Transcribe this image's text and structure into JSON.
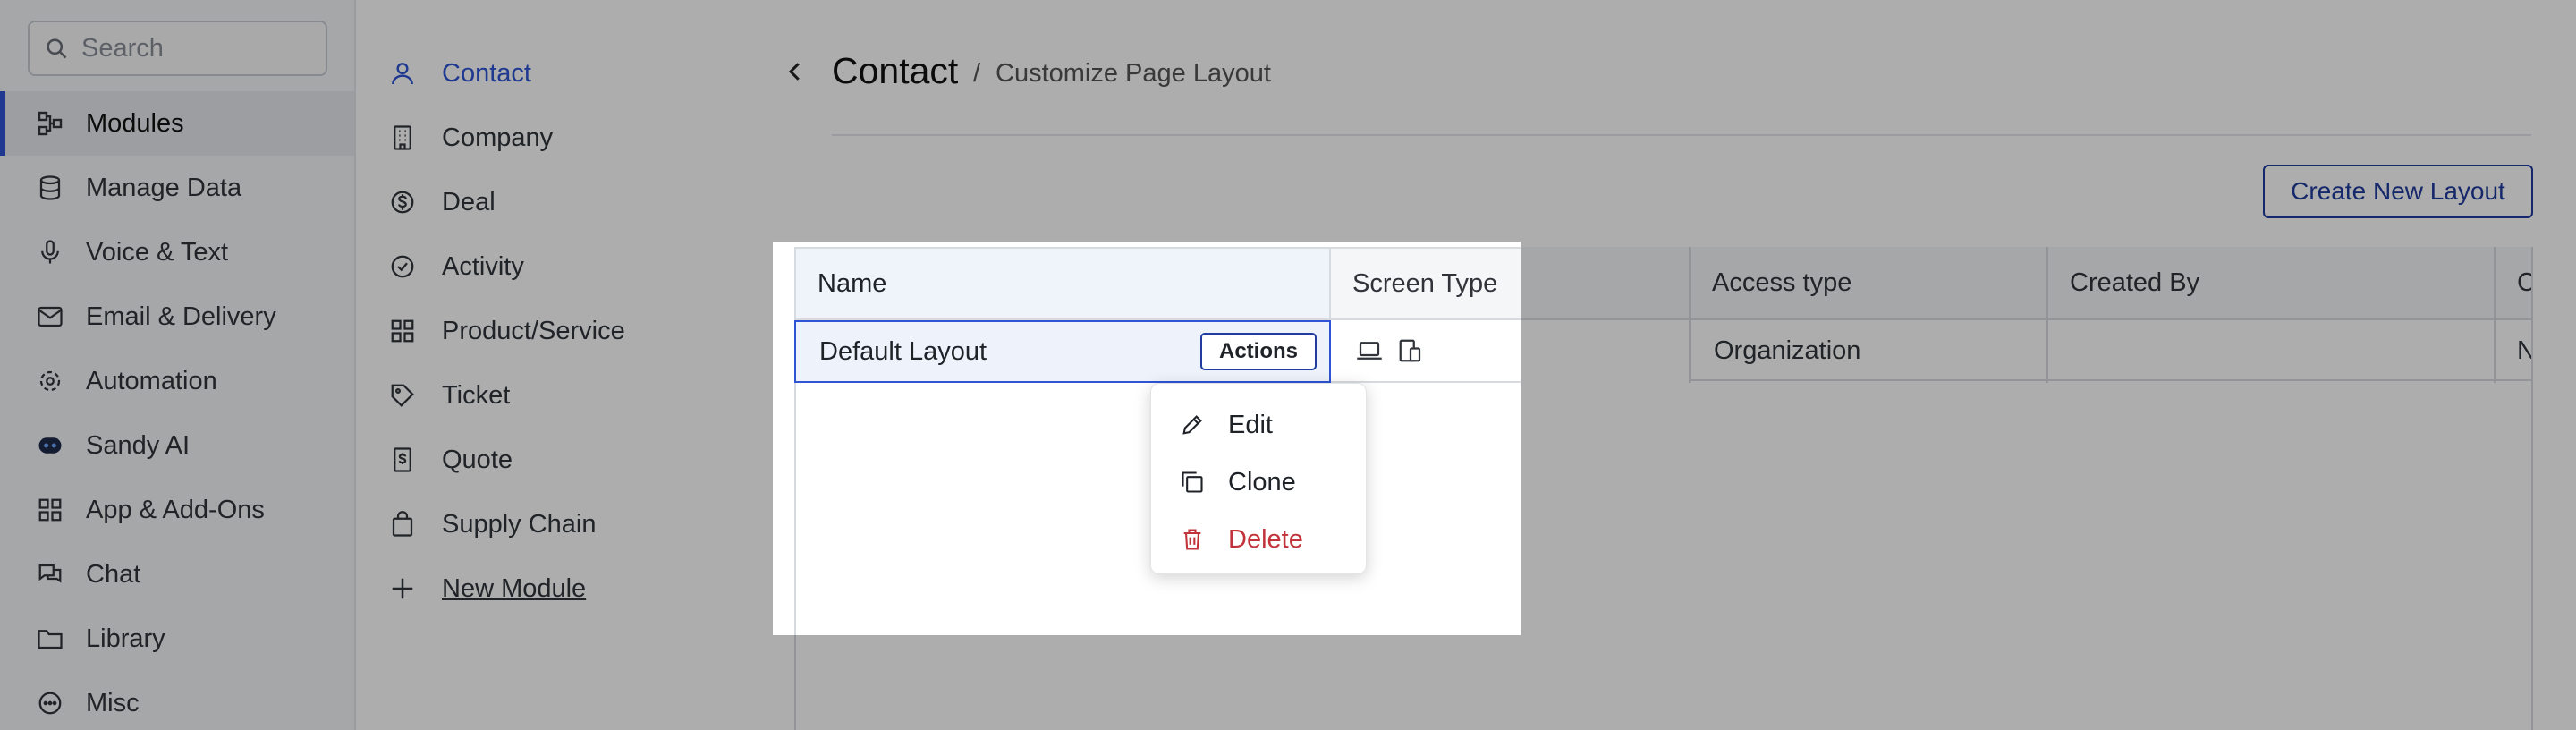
{
  "search": {
    "placeholder": "Search"
  },
  "sidebar": {
    "items": [
      {
        "label": "Modules",
        "icon": "modules-icon",
        "active": true
      },
      {
        "label": "Manage Data",
        "icon": "database-icon"
      },
      {
        "label": "Voice & Text",
        "icon": "microphone-icon"
      },
      {
        "label": "Email & Delivery",
        "icon": "mail-icon"
      },
      {
        "label": "Automation",
        "icon": "automation-icon"
      },
      {
        "label": "Sandy AI",
        "icon": "robot-icon"
      },
      {
        "label": "App & Add-Ons",
        "icon": "apps-icon"
      },
      {
        "label": "Chat",
        "icon": "chat-icon"
      },
      {
        "label": "Library",
        "icon": "folder-icon"
      },
      {
        "label": "Misc",
        "icon": "more-icon"
      }
    ]
  },
  "modules": {
    "items": [
      {
        "label": "Contact",
        "icon": "user-icon",
        "active": true
      },
      {
        "label": "Company",
        "icon": "building-icon"
      },
      {
        "label": "Deal",
        "icon": "dollar-icon"
      },
      {
        "label": "Activity",
        "icon": "check-circle-icon"
      },
      {
        "label": "Product/Service",
        "icon": "grid-icon"
      },
      {
        "label": "Ticket",
        "icon": "ticket-icon"
      },
      {
        "label": "Quote",
        "icon": "quote-icon"
      },
      {
        "label": "Supply Chain",
        "icon": "bag-icon"
      },
      {
        "label": "New Module",
        "icon": "plus-icon"
      }
    ]
  },
  "header": {
    "title": "Contact",
    "separator": "/",
    "subtitle": "Customize Page Layout",
    "create_button": "Create New Layout"
  },
  "table": {
    "columns": [
      "Name",
      "Screen Type",
      "Access type",
      "Created By",
      "C"
    ],
    "rows": [
      {
        "name": "Default Layout",
        "screen_type": [
          "laptop-icon",
          "devices-icon"
        ],
        "access_type": "Organization",
        "created_by": "",
        "extra": "N"
      }
    ],
    "actions_label": "Actions"
  },
  "menu": {
    "items": [
      {
        "label": "Edit",
        "icon": "pencil-icon"
      },
      {
        "label": "Clone",
        "icon": "copy-icon"
      },
      {
        "label": "Delete",
        "icon": "trash-icon"
      }
    ]
  },
  "colors": {
    "accent": "#2f54d6",
    "button_border": "#1f3c9e",
    "danger": "#c2333b",
    "overlay": "rgba(0,0,0,0.32)"
  }
}
